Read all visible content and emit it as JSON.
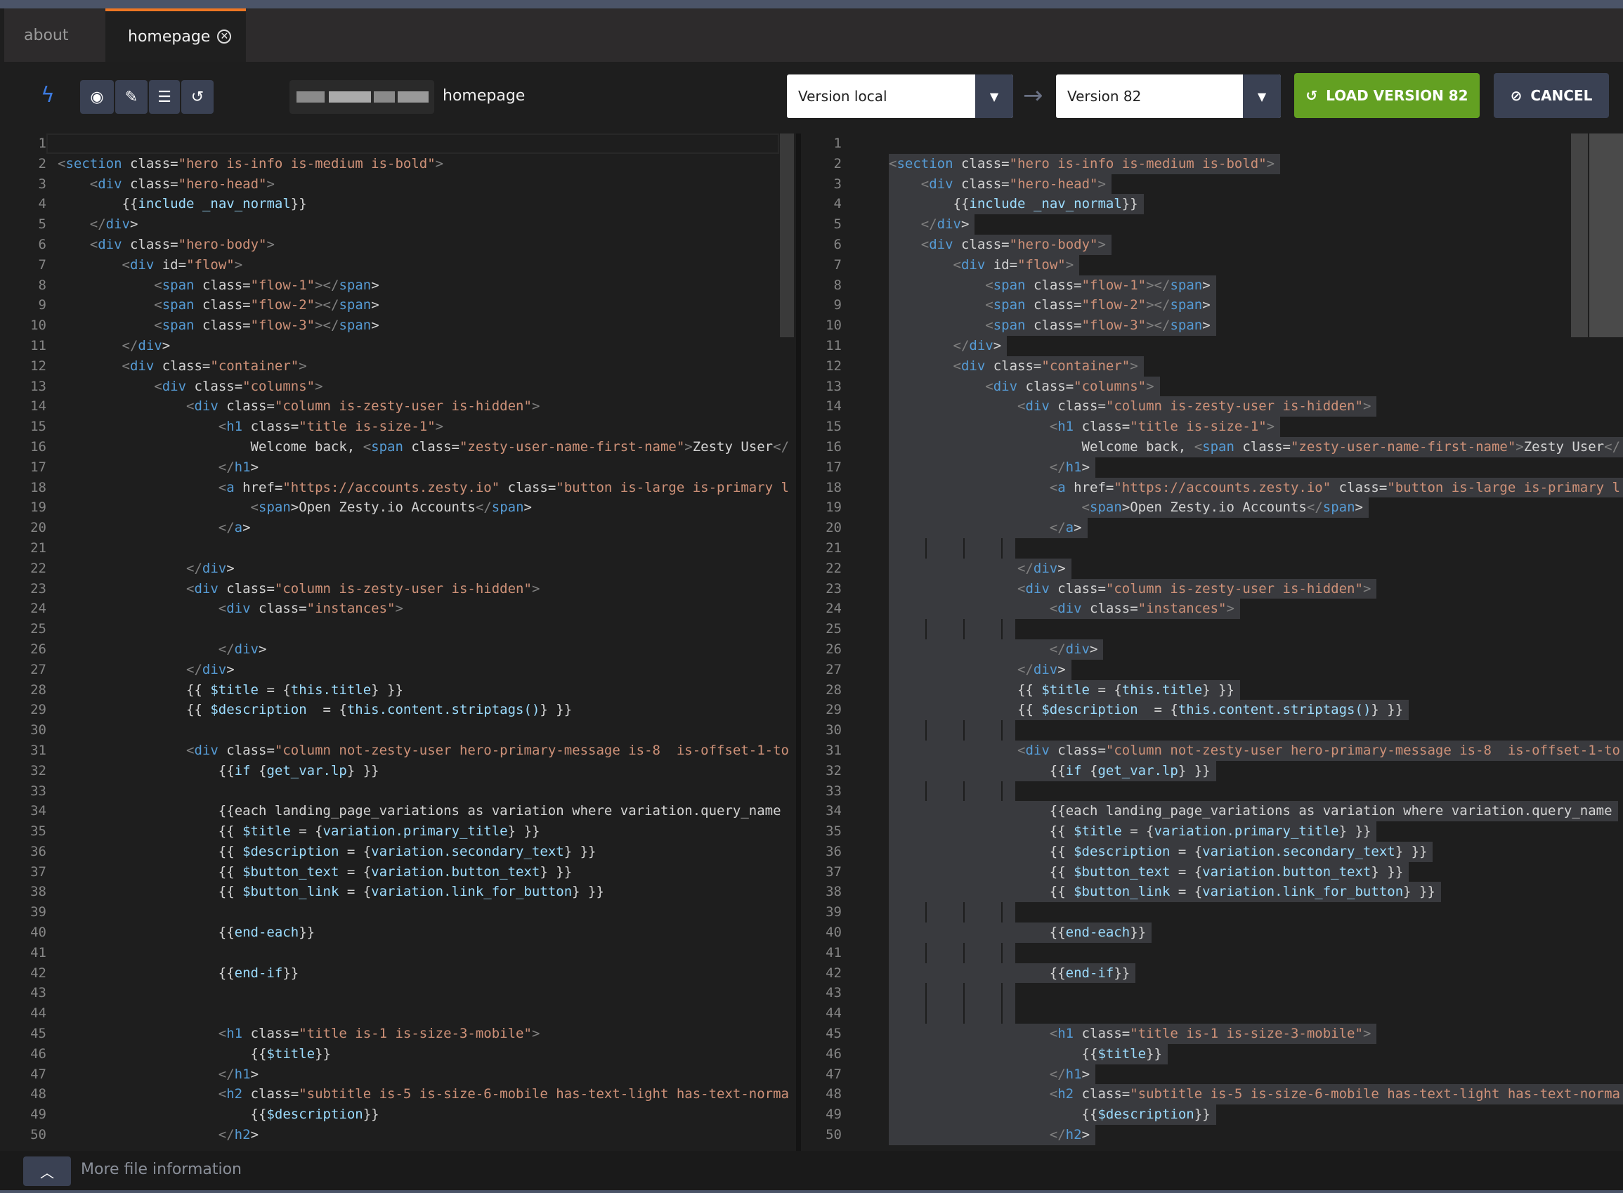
{
  "tabs": [
    {
      "label": "about",
      "active": false
    },
    {
      "label": "homepage",
      "active": true
    }
  ],
  "toolbar": {
    "icons": [
      "lightning-icon",
      "eye-icon",
      "edit-icon",
      "database-icon",
      "history-icon"
    ],
    "file_name": "homepage",
    "version_from": "Version local",
    "version_to": "Version 82",
    "load_label": "LOAD VERSION 82",
    "cancel_label": "CANCEL"
  },
  "colors": {
    "accent_tab": "#ee7623",
    "load_button": "#63a022",
    "button": "#3a4153",
    "tag": "#569cd6",
    "attr": "#9cdcfe",
    "string": "#ce9178"
  },
  "code_lines": [
    "",
    "<section class=\"hero is-info is-medium is-bold\">",
    "    <div class=\"hero-head\">",
    "        {{include _nav_normal}}",
    "    </div>",
    "    <div class=\"hero-body\">",
    "        <div id=\"flow\">",
    "            <span class=\"flow-1\"></span>",
    "            <span class=\"flow-2\"></span>",
    "            <span class=\"flow-3\"></span>",
    "        </div>",
    "        <div class=\"container\">",
    "            <div class=\"columns\">",
    "                <div class=\"column is-zesty-user is-hidden\">",
    "                    <h1 class=\"title is-size-1\">",
    "                        Welcome back, <span class=\"zesty-user-name-first-name\">Zesty User</",
    "                    </h1>",
    "                    <a href=\"https://accounts.zesty.io\" class=\"button is-large is-primary l",
    "                        <span>Open Zesty.io Accounts</span>",
    "                    </a>",
    "",
    "                </div>",
    "                <div class=\"column is-zesty-user is-hidden\">",
    "                    <div class=\"instances\">",
    "",
    "                    </div>",
    "                </div>",
    "                {{ $title = {this.title} }}",
    "                {{ $description  = {this.content.striptags()} }}",
    "",
    "                <div class=\"column not-zesty-user hero-primary-message is-8  is-offset-1-to",
    "                    {{if {get_var.lp} }}",
    "",
    "                    {{each landing_page_variations as variation where variation.query_name",
    "                    {{ $title = {variation.primary_title} }}",
    "                    {{ $description = {variation.secondary_text} }}",
    "                    {{ $button_text = {variation.button_text} }}",
    "                    {{ $button_link = {variation.link_for_button} }}",
    "",
    "                    {{end-each}}",
    "",
    "                    {{end-if}}",
    "",
    "",
    "                    <h1 class=\"title is-1 is-size-3-mobile\">",
    "                        {{$title}}",
    "                    </h1>",
    "                    <h2 class=\"subtitle is-5 is-size-6-mobile has-text-light has-text-norma",
    "                        {{$description}}",
    "                    </h2>"
  ],
  "footer": {
    "more_label": "More file information"
  }
}
